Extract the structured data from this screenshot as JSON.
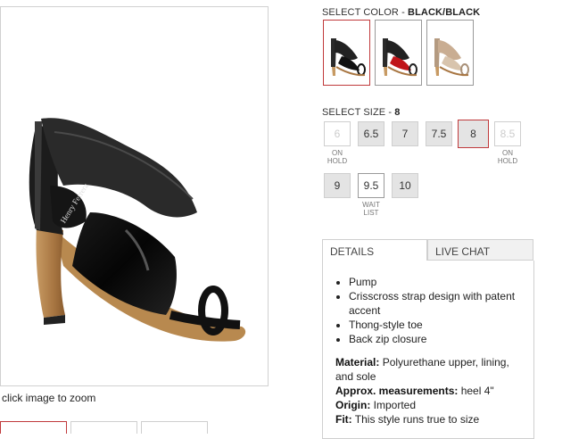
{
  "image": {
    "zoom_hint": "click image to zoom",
    "label_text": "Henry Ferrera"
  },
  "color": {
    "label": "SELECT COLOR - ",
    "selected": "BLACK/BLACK",
    "swatches": [
      "black",
      "red",
      "beige"
    ]
  },
  "size": {
    "label": "SELECT SIZE - ",
    "selected": "8",
    "options": [
      {
        "label": "6",
        "state": "hold",
        "note_1": "ON",
        "note_2": "HOLD"
      },
      {
        "label": "6.5",
        "state": "available"
      },
      {
        "label": "7",
        "state": "available"
      },
      {
        "label": "7.5",
        "state": "available"
      },
      {
        "label": "8",
        "state": "selected"
      },
      {
        "label": "8.5",
        "state": "hold",
        "note_1": "ON",
        "note_2": "HOLD"
      },
      {
        "label": "9",
        "state": "available"
      },
      {
        "label": "9.5",
        "state": "waitlist",
        "note_1": "WAIT",
        "note_2": "LIST"
      },
      {
        "label": "10",
        "state": "available"
      }
    ]
  },
  "tabs": {
    "details": "DETAILS",
    "chat": "LIVE CHAT"
  },
  "details": {
    "bullets": [
      "Pump",
      "Crisscross strap design with patent accent",
      "Thong-style toe",
      "Back zip closure"
    ],
    "material_label": "Material:",
    "material_value": " Polyurethane upper, lining, and sole",
    "measure_label": "Approx. measurements:",
    "measure_value": " heel 4\"",
    "origin_label": "Origin:",
    "origin_value": " Imported",
    "fit_label": "Fit:",
    "fit_value": " This style runs true to size"
  },
  "colors": {
    "accent": "#c0393b",
    "size_bg": "#e4e4e4",
    "border": "#cfcfcf"
  }
}
